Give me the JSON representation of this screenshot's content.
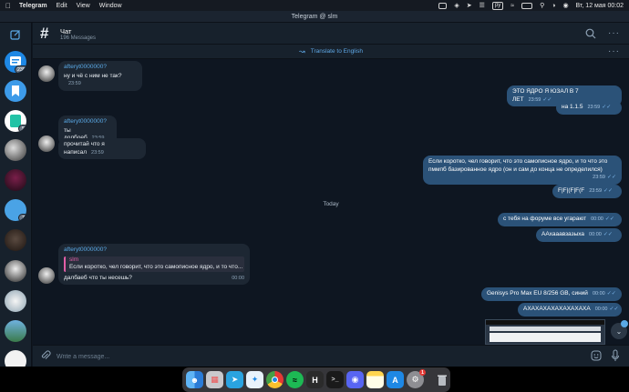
{
  "menubar": {
    "app_name": "Telegram",
    "menus": [
      "Edit",
      "View",
      "Window"
    ],
    "ya_badge": "ру",
    "datetime": "Вт, 12 мая  00:02"
  },
  "window": {
    "title": "Telegram @ slm"
  },
  "sidebar": {
    "badges": {
      "chat1": "235",
      "chat3": "5",
      "chat8": "7"
    }
  },
  "chat": {
    "title": "Чат",
    "subtitle": "196 Messages",
    "translate_label": "Translate to English"
  },
  "messages": {
    "m1": {
      "sender": "afteryt0000000?",
      "text": "ну и чё с ним не так?",
      "time": "23:59"
    },
    "m2": {
      "text": "ЭТО ЯДРО Я ЮЗАЛ В 7 ЛЕТ",
      "time": "23:59"
    },
    "m3": {
      "text": "на 1.1.5",
      "time": "23:59"
    },
    "m4": {
      "sender": "afteryt0000000?",
      "text": "ты долбоеб",
      "time": "23:59"
    },
    "m5": {
      "text": "прочитай что я написал",
      "time": "23:59"
    },
    "m6": {
      "line1": "Если коротко, чел говорит, что это самописное ядро, и то что это",
      "line2": "пммпб базированное ядро (он и сам до конца не определился)",
      "time": "23:59"
    },
    "m7": {
      "text": "F|F|(F|F(F",
      "time": "23:59"
    },
    "date_sep": "Today",
    "m8": {
      "text": "с тебя на форуме все угарают",
      "time": "00:00"
    },
    "m9": {
      "text": "ААхааавзазыха",
      "time": "00:00"
    },
    "m10": {
      "sender": "afteryt0000000?",
      "reply_name": "slm",
      "reply_text": "Если коротко, чел говорит, что это самописное ядро, и то что...",
      "text": "далбаеб что ты несешь?",
      "time": "00:00"
    },
    "m11": {
      "text": "Genisys Pro Max EU 8/256 GB, синий",
      "time": "00:00"
    },
    "m12": {
      "text": "АХАХАХАХАХАХАХАХА",
      "time": "00:00"
    }
  },
  "composer": {
    "placeholder": "Write a message..."
  },
  "dock": {
    "badge_count": "1"
  }
}
